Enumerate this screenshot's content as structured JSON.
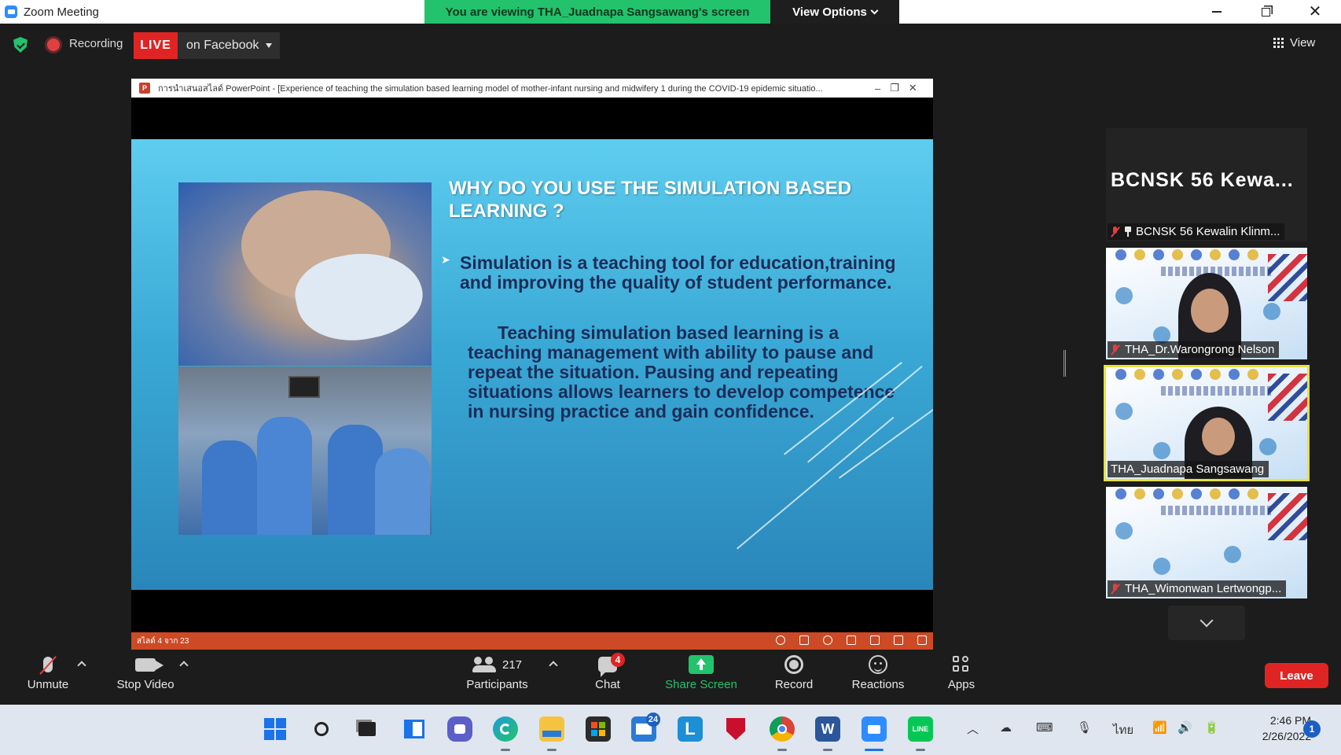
{
  "window": {
    "title": "Zoom Meeting",
    "viewing_banner": "You are viewing THA_Juadnapa Sangsawang's screen",
    "view_options": "View Options"
  },
  "toolbar_top": {
    "recording_label": "Recording",
    "live_label": "LIVE",
    "live_destination": "on Facebook",
    "view_label": "View"
  },
  "shared_screen": {
    "ppt_title": "การนำเสนอสไลด์ PowerPoint - [Experience of teaching the simulation based learning model of mother-infant nursing and midwifery 1 during the COVID-19 epidemic situatio...",
    "slide_title": "WHY DO YOU USE THE SIMULATION BASED LEARNING ?",
    "slide_paragraph_1": "Simulation is a teaching tool for education,training and improving the quality of student performance.",
    "slide_paragraph_2": "Teaching simulation based learning is a teaching management with ability to pause and repeat the situation. Pausing and repeating situations allows learners to develop competence in nursing practice and gain confidence.",
    "status_text": "สไลด์ 4 จาก 23"
  },
  "participants": [
    {
      "big_name": "BCNSK 56 Kewa...",
      "label": "BCNSK 56 Kewalin Klinm...",
      "muted": true,
      "pinned": true,
      "video": false
    },
    {
      "label": "THA_Dr.Warongrong Nelson",
      "muted": true,
      "video": true
    },
    {
      "label": "THA_Juadnapa Sangsawang",
      "muted": false,
      "video": true,
      "active": true
    },
    {
      "label": "THA_Wimonwan Lertwongp...",
      "muted": true,
      "video": true
    }
  ],
  "bottom_toolbar": {
    "unmute": "Unmute",
    "stop_video": "Stop Video",
    "participants_count": "217",
    "participants": "Participants",
    "chat": "Chat",
    "chat_badge": "4",
    "share_screen": "Share Screen",
    "record": "Record",
    "reactions": "Reactions",
    "apps": "Apps",
    "leave": "Leave"
  },
  "taskbar": {
    "mail_badge": "24",
    "language": "ไทย",
    "time": "2:46 PM",
    "date": "2/26/2022",
    "notification_count": "1"
  },
  "colors": {
    "zoom_green": "#23c26c",
    "live_red": "#e02424",
    "active_speaker_yellow": "#e8e23d",
    "slide_blue": "#3aa9d6",
    "slide_text_navy": "#1b2d58"
  }
}
